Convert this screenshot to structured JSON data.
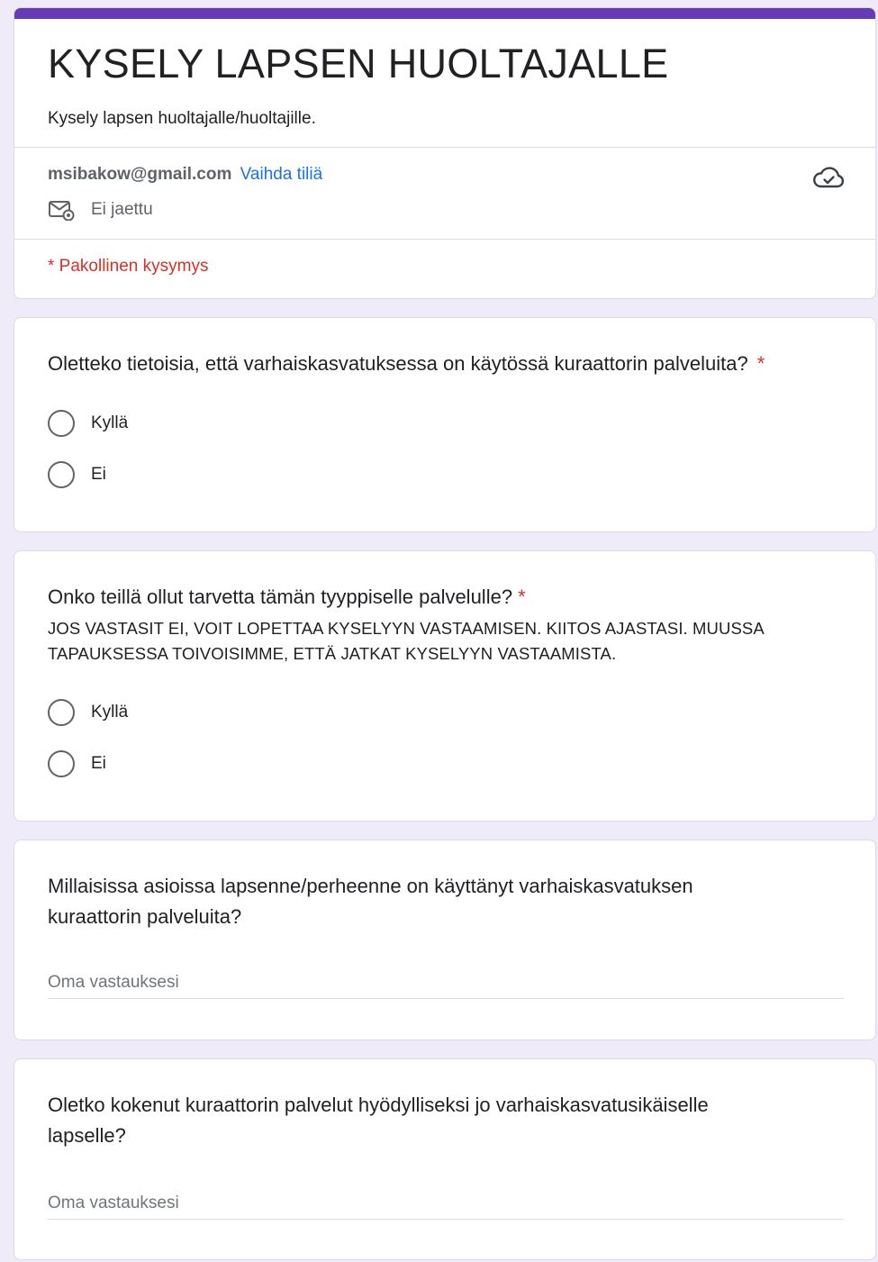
{
  "header": {
    "title": "KYSELY LAPSEN HUOLTAJALLE",
    "description": "Kysely lapsen huoltajalle/huoltajille.",
    "email": "msibakow@gmail.com",
    "switch_account": "Vaihda tiliä",
    "shared_status": "Ei jaettu",
    "required_note": "* Pakollinen kysymys",
    "accent_color": "#673ab7",
    "icons": [
      "cloud-saved-icon",
      "mail-shared-icon"
    ]
  },
  "questions": [
    {
      "title": "Oletteko tietoisia, että varhaiskasvatuksessa on käytössä kuraattorin palveluita?",
      "required_mark": "*",
      "options": [
        "Kyllä",
        "Ei"
      ]
    },
    {
      "title": "Onko teillä ollut tarvetta tämän tyyppiselle palvelulle?",
      "required_mark": "*",
      "help": "JOS VASTASIT EI, VOIT LOPETTAA KYSELYYN VASTAAMISEN. KIITOS AJASTASI. MUUSSA TAPAUKSESSA TOIVOISIMME, ETTÄ JATKAT KYSELYYN VASTAAMISTA.",
      "options": [
        "Kyllä",
        "Ei"
      ]
    },
    {
      "title_line1": "Millaisissa asioissa lapsenne/perheenne on käyttänyt varhaiskasvatuksen",
      "title_line2": "kuraattorin palveluita?",
      "placeholder": "Oma vastauksesi"
    },
    {
      "title_line1": "Oletko kokenut kuraattorin palvelut hyödylliseksi jo varhaiskasvatusikäiselle",
      "title_line2": "lapselle?",
      "placeholder": "Oma vastauksesi"
    }
  ]
}
